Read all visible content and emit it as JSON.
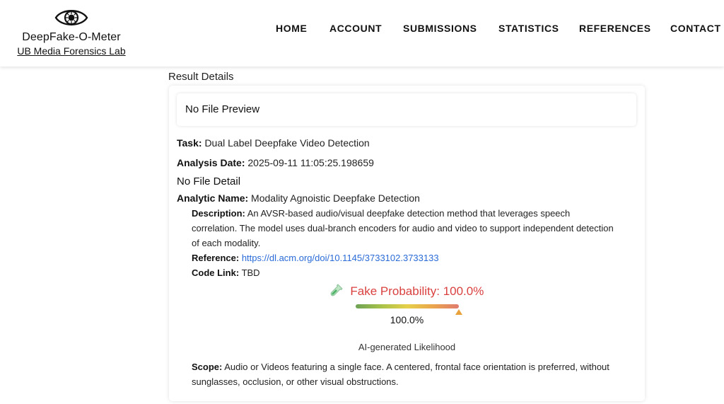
{
  "brand": {
    "name": "DeepFake-O-Meter",
    "lab_link": "UB Media Forensics Lab",
    "logo_icon": "eye-icon"
  },
  "nav": [
    "HOME",
    "ACCOUNT",
    "SUBMISSIONS",
    "STATISTICS",
    "REFERENCES",
    "CONTACT"
  ],
  "page": {
    "section_title": "Result Details",
    "no_file_preview": "No File Preview",
    "task_label": "Task:",
    "task_value": "Dual Label Deepfake Video Detection",
    "date_label": "Analysis Date:",
    "date_value": "2025-09-11 11:05:25.198659",
    "no_file_detail": "No File Detail",
    "analytic_label": "Analytic Name:",
    "analytic_value": "Modality Agnoistic Deepfake Detection",
    "description_label": "Description:",
    "description_value": "An AVSR-based audio/visual deepfake detection method that leverages speech correlation. The model uses dual-branch encoders for audio and video to support independent detection of each modality.",
    "reference_label": "Reference:",
    "reference_link": "https://dl.acm.org/doi/10.1145/3733102.3733133",
    "code_label": "Code Link:",
    "code_value": "TBD",
    "probability_text": "Fake Probability: 100.0%",
    "probability_icon": "flask-icon",
    "probability_fraction": 1.0,
    "bar_value": "100.0%",
    "likelihood_label": "AI-generated Likelihood",
    "scope_label": "Scope:",
    "scope_value": "Audio or Videos featuring a single face. A centered, frontal face orientation is preferred, without sunglasses, occlusion, or other visual obstructions."
  },
  "colors": {
    "probability_text": "#d9413f",
    "link": "#2a6bd8",
    "marker": "#e9a23b"
  }
}
